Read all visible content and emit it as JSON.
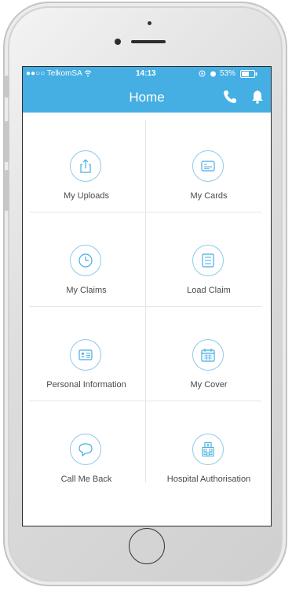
{
  "status_bar": {
    "carrier": "●●○○ TelkomSA",
    "time": "14:13",
    "battery": "53%"
  },
  "nav": {
    "title": "Home"
  },
  "colors": {
    "accent": "#45aee3",
    "icon_stroke": "#45aee3"
  },
  "tiles": [
    {
      "label": "My Uploads",
      "icon": "upload-icon"
    },
    {
      "label": "My Cards",
      "icon": "card-icon"
    },
    {
      "label": "My Claims",
      "icon": "clock-icon"
    },
    {
      "label": "Load Claim",
      "icon": "checklist-icon"
    },
    {
      "label": "Personal Information",
      "icon": "id-card-icon"
    },
    {
      "label": "My Cover",
      "icon": "calendar-icon"
    },
    {
      "label": "Call Me Back",
      "icon": "chat-bubble-icon"
    },
    {
      "label": "Hospital Authorisation",
      "icon": "hospital-icon"
    }
  ]
}
